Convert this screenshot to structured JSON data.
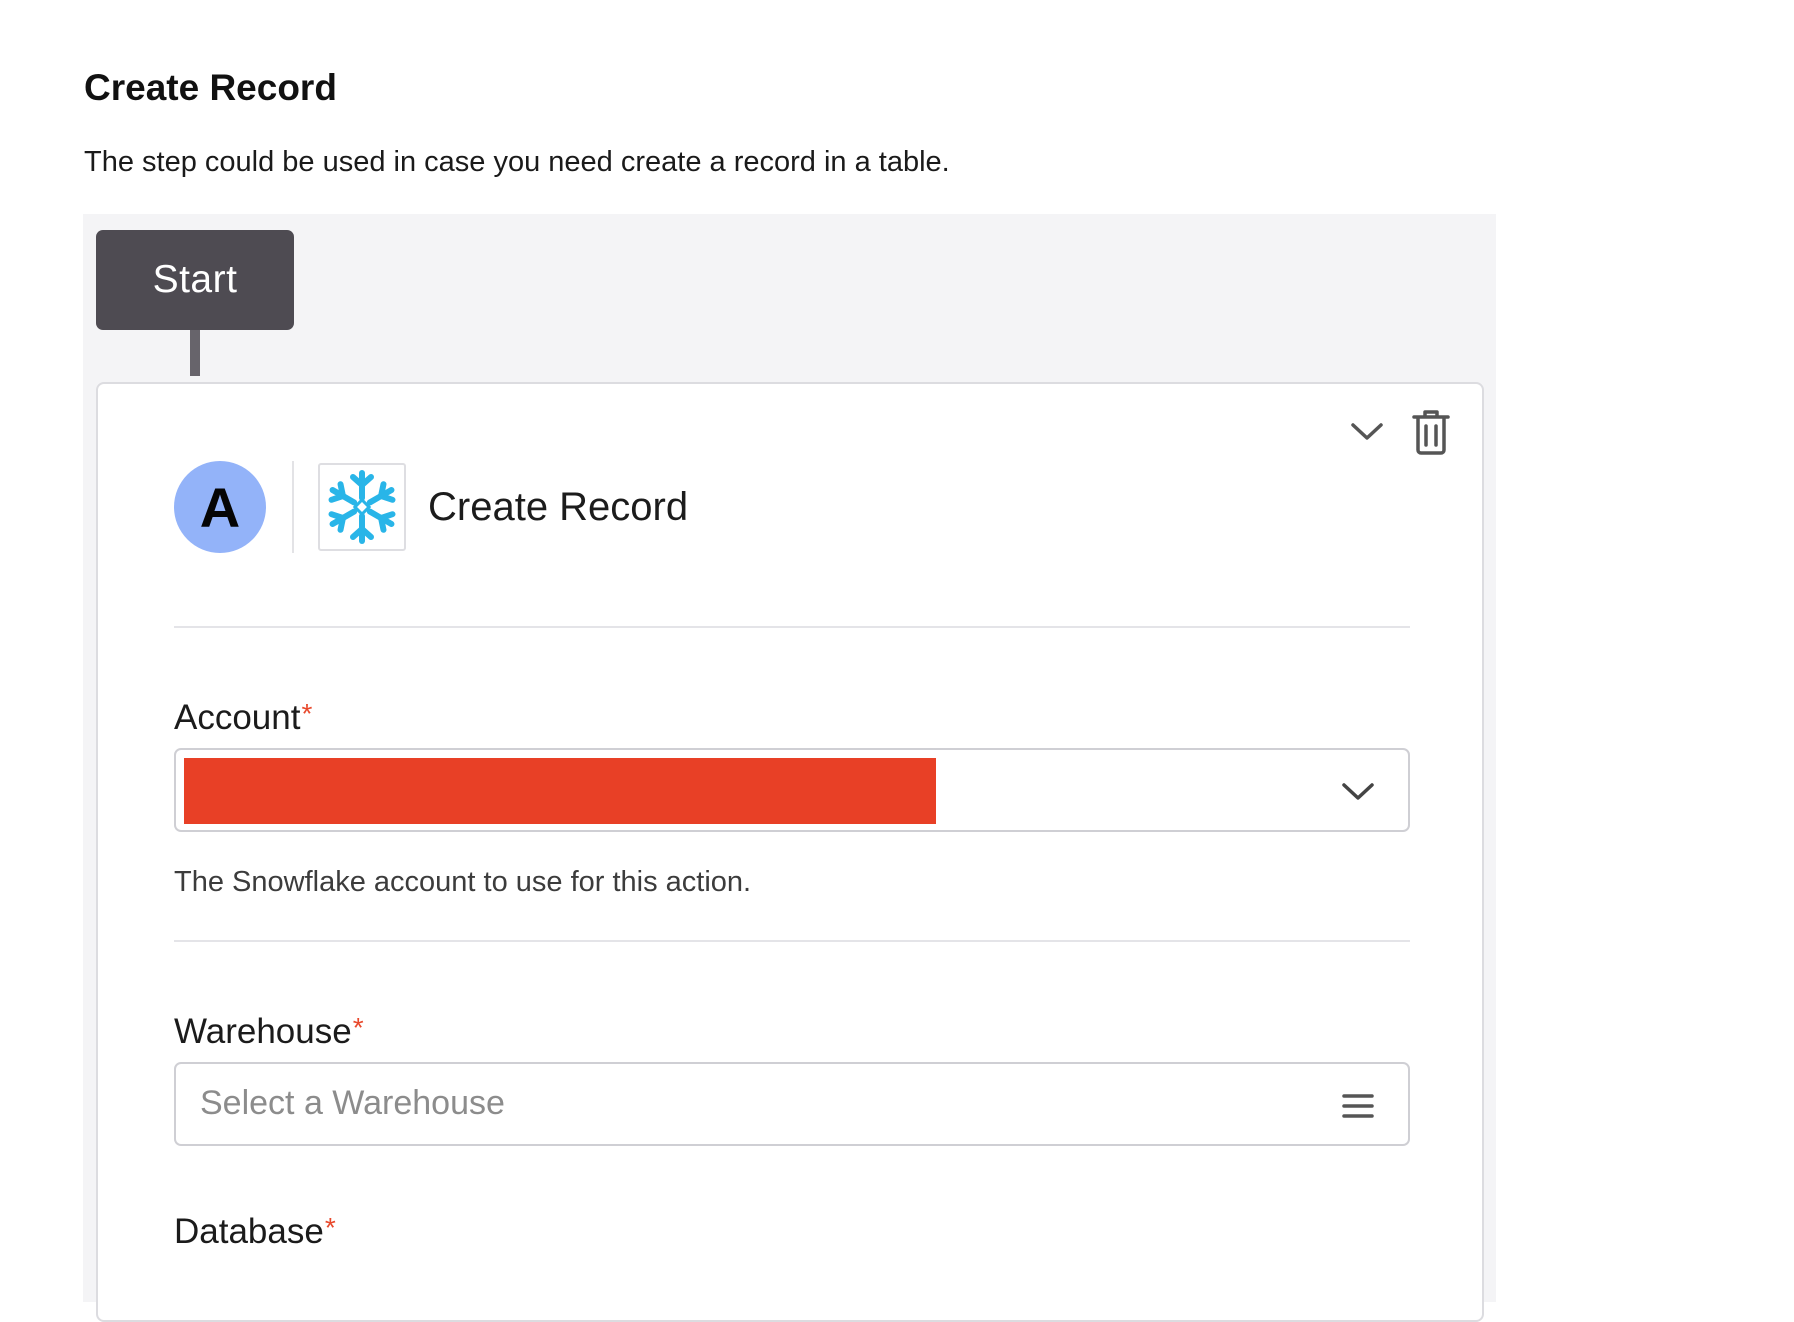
{
  "doc": {
    "title": "Create Record",
    "description": "The step could be used in case you need create a record in a table."
  },
  "flow": {
    "start_label": "Start"
  },
  "step": {
    "avatar_letter": "A",
    "app_icon": "snowflake-logo",
    "name": "Create Record",
    "actions": {
      "collapse_icon": "chevron-down-icon",
      "delete_icon": "trash-icon"
    }
  },
  "fields": {
    "account": {
      "label": "Account",
      "required_mark": "*",
      "value_redacted": true,
      "help": "The Snowflake account to use for this action."
    },
    "warehouse": {
      "label": "Warehouse",
      "required_mark": "*",
      "placeholder": "Select a Warehouse"
    },
    "database": {
      "label": "Database",
      "required_mark": "*"
    }
  },
  "colors": {
    "start_node": "#4e4b52",
    "avatar": "#93b3f9",
    "required": "#e8492c",
    "redaction": "#e84026",
    "snowflake": "#29b5e8"
  }
}
